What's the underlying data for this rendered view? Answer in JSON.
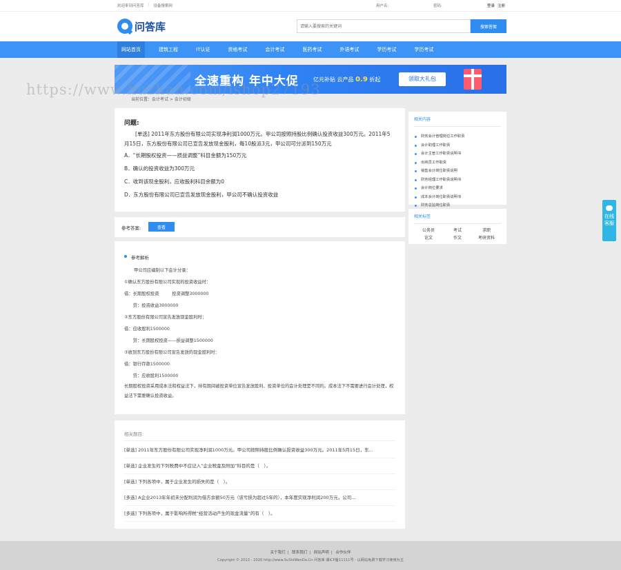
{
  "topbar": {
    "left_links": [
      "欢迎来到问答库",
      "设备搜索网"
    ],
    "username_label": "用户名:",
    "password_label": "密码:",
    "right_links": [
      "登录",
      "注册"
    ]
  },
  "header": {
    "logo_text": "问答库",
    "search_placeholder": "请输入要搜索的关键词",
    "search_button": "搜索答案"
  },
  "nav": {
    "items": [
      "网站首页",
      "建筑工程",
      "IT认证",
      "资格考试",
      "会计考试",
      "医药考试",
      "外语考试",
      "学历考试",
      "学历考试"
    ]
  },
  "banner": {
    "headline": "全速重构 年中大促",
    "sub_prefix": "亿元补贴 云产品",
    "sub_discount": "0.9",
    "sub_suffix": "折起",
    "cta": "领取大礼包"
  },
  "watermark": "https://www.huzhan.com/ishop27193",
  "breadcrumb": "当前位置：会计考试 > 会计初级",
  "question": {
    "title": "问题:",
    "body": "[单选] 2011年东方股份有限公司实现净利润1000万元。甲公司按照持股比例确认投资收益300万元。2011年5月15日，东方股份有限公司已宣告发放现金股利，每10股派3元，甲公司可分派到150万元",
    "options": [
      "A．“长期股权投资——损益调整”科目金额为150万元",
      "B．确认的投资收益为300万元",
      "C．收到该现金股利，应收股利科目余额为0",
      "D．东方股份有限公司已宣告发放现金股利，甲公司不确认投资收益"
    ]
  },
  "answer": {
    "label": "参考答案:",
    "button": "查看"
  },
  "analysis": {
    "title": "参考解析",
    "lines": [
      "甲公司应编制以下会计分录：",
      "①确认东方股份有限公司实现的投资收益时：",
      "借：长期股权投资　　　投资调整3000000",
      "　　贷：投资收益3000000",
      "②东方股份有限公司宣告发放现金股利时：",
      "借：应收股利1500000",
      "　　贷：长期股权投资——损益调整1500000",
      "③收到东方股份有限公司宣告发放的现金股利时：",
      "借：银行存款1500000",
      "　　贷：应收股利1500000"
    ],
    "paragraph": "长期股权投资采用成本法和权益法下，持有期间被投资单位宣告发放股利、投资单位的会计处理是不同的。成本法下不需要进行会计处理，权益法下需要确认投资收益。"
  },
  "related_questions": {
    "title": "相关题目:",
    "items": [
      "[单选] 2011年东方股份有限公司实现净利润1000万元。甲公司按照持股比例确认投资收益300万元。2011年5月15日，东...",
      "[单选] 企业发生的下列税费中不应记入“企业税金及附加”科目的是（　）。",
      "[单选] 下列各项中，属于企业发生的损失的是（　）。",
      "[多选] A企业2013年年初未分配利润为借方余额50万元（该亏损为超过5年的），本年度实现净利润200万元，公司...",
      "[多选] 下列各项中，属于影响所得税“经营活动产生的现金流量”的有（　）。"
    ]
  },
  "sidebar": {
    "related_title": "相关内容",
    "related_items": [
      "财务会计管理岗位工作职责",
      "会计助理工作职责",
      "会计主管工作职责说明书",
      "出纳员工作职责",
      "销售会计岗位职责说明",
      "财务经理工作职责说明书",
      "会计岗位要求",
      "成本会计岗位职责说明书",
      "财务总监岗位职责"
    ],
    "tags_title": "相关标签",
    "tags": [
      "公务员",
      "考试",
      "求职",
      "论文",
      "作文",
      "考研资料"
    ]
  },
  "float_help": {
    "label": "在线客服"
  },
  "footer": {
    "links": [
      "关于我们",
      "联系我们",
      "网站声明",
      "合作伙伴"
    ],
    "copyright": "Copyright © 2013 - 2020 http://www.SuShiWenDa.Cn 问答库 湘ICP备11111号 · 以网站免费下载学习使用为主"
  }
}
